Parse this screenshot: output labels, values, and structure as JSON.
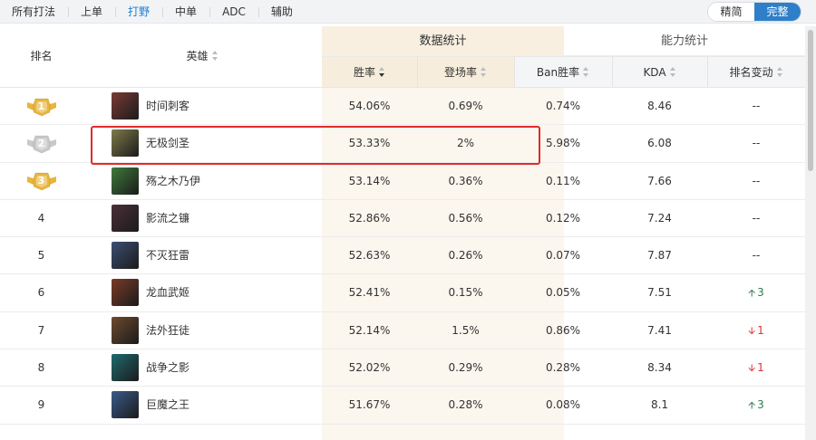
{
  "tabs": [
    {
      "label": "所有打法",
      "active": false
    },
    {
      "label": "上单",
      "active": false
    },
    {
      "label": "打野",
      "active": true
    },
    {
      "label": "中单",
      "active": false
    },
    {
      "label": "ADC",
      "active": false
    },
    {
      "label": "辅助",
      "active": false
    }
  ],
  "view_toggle": {
    "simple": "精简",
    "full": "完整",
    "selected": "完整"
  },
  "table": {
    "group_headers": {
      "data_stats": "数据统计",
      "ability_stats": "能力统计"
    },
    "columns": {
      "rank": "排名",
      "hero": "英雄",
      "win_rate": "胜率",
      "pick_rate": "登场率",
      "ban_rate": "Ban胜率",
      "kda": "KDA",
      "rank_change": "排名变动"
    },
    "sorted_by": "胜率",
    "rows": [
      {
        "rank": "1",
        "medal": "gold",
        "hero": "时间刺客",
        "avatar_color": "#7a3b36",
        "win_rate": "54.06%",
        "pick_rate": "0.69%",
        "ban_rate": "0.74%",
        "kda": "8.46",
        "change": "--",
        "change_dir": "none"
      },
      {
        "rank": "2",
        "medal": "silver",
        "hero": "无极剑圣",
        "avatar_color": "#7f7a4a",
        "win_rate": "53.33%",
        "pick_rate": "2%",
        "ban_rate": "5.98%",
        "kda": "6.08",
        "change": "--",
        "change_dir": "none"
      },
      {
        "rank": "3",
        "medal": "gold",
        "hero": "殇之木乃伊",
        "avatar_color": "#3f7a3a",
        "win_rate": "53.14%",
        "pick_rate": "0.36%",
        "ban_rate": "0.11%",
        "kda": "7.66",
        "change": "--",
        "change_dir": "none"
      },
      {
        "rank": "4",
        "medal": "",
        "hero": "影流之镰",
        "avatar_color": "#4a3038",
        "win_rate": "52.86%",
        "pick_rate": "0.56%",
        "ban_rate": "0.12%",
        "kda": "7.24",
        "change": "--",
        "change_dir": "none"
      },
      {
        "rank": "5",
        "medal": "",
        "hero": "不灭狂雷",
        "avatar_color": "#3c4f73",
        "win_rate": "52.63%",
        "pick_rate": "0.26%",
        "ban_rate": "0.07%",
        "kda": "7.87",
        "change": "--",
        "change_dir": "none"
      },
      {
        "rank": "6",
        "medal": "",
        "hero": "龙血武姬",
        "avatar_color": "#7a3a28",
        "win_rate": "52.41%",
        "pick_rate": "0.15%",
        "ban_rate": "0.05%",
        "kda": "7.51",
        "change": "3",
        "change_dir": "up"
      },
      {
        "rank": "7",
        "medal": "",
        "hero": "法外狂徒",
        "avatar_color": "#6e4a2e",
        "win_rate": "52.14%",
        "pick_rate": "1.5%",
        "ban_rate": "0.86%",
        "kda": "7.41",
        "change": "1",
        "change_dir": "down"
      },
      {
        "rank": "8",
        "medal": "",
        "hero": "战争之影",
        "avatar_color": "#1f6a6f",
        "win_rate": "52.02%",
        "pick_rate": "0.29%",
        "ban_rate": "0.28%",
        "kda": "8.34",
        "change": "1",
        "change_dir": "down"
      },
      {
        "rank": "9",
        "medal": "",
        "hero": "巨魔之王",
        "avatar_color": "#3a5a8a",
        "win_rate": "51.67%",
        "pick_rate": "0.28%",
        "ban_rate": "0.08%",
        "kda": "8.1",
        "change": "3",
        "change_dir": "up"
      }
    ]
  },
  "colors": {
    "accent_blue": "#2f7fc8",
    "data_column_bg": "#fbf6ee",
    "highlight_border": "#e02b2b",
    "up_arrow": "#2e7d4f",
    "down_arrow": "#d33333",
    "gold_medal": "#e9b53c",
    "silver_medal": "#c9c9c9"
  }
}
